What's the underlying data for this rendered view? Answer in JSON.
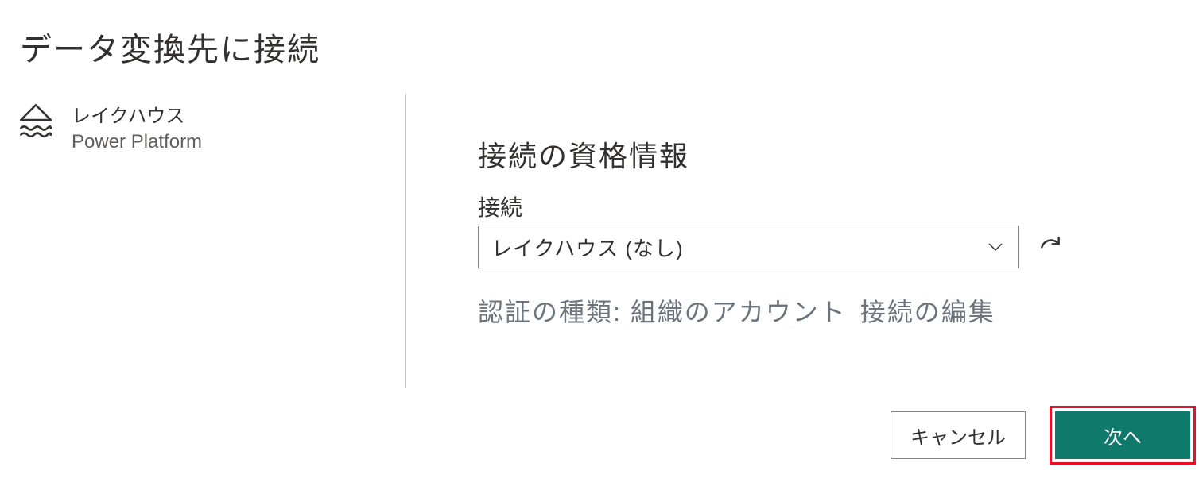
{
  "page": {
    "title": "データ変換先に接続"
  },
  "source": {
    "name": "レイクハウス",
    "platform": "Power Platform"
  },
  "credentials": {
    "section_title": "接続の資格情報",
    "connection_label": "接続",
    "connection_value": "レイクハウス (なし)",
    "auth_type_label": "認証の種類:",
    "auth_type_value": "組織のアカウント",
    "edit_link": "接続の編集"
  },
  "footer": {
    "cancel": "キャンセル",
    "next": "次へ"
  }
}
